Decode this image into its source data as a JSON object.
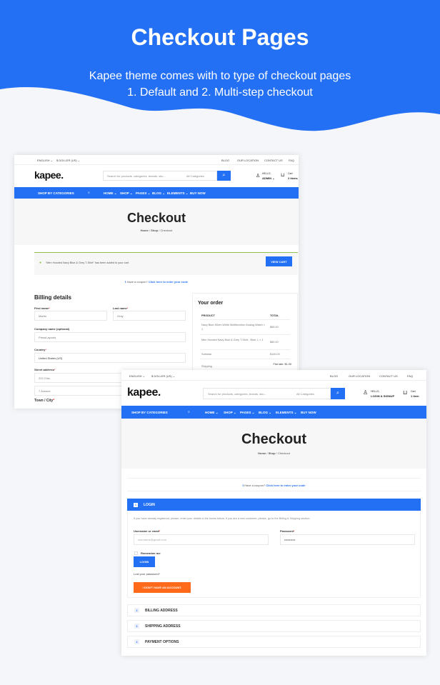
{
  "banner": {
    "title": "Checkout Pages",
    "line1": "Kapee theme comes with to type of  checkout pages",
    "line2": "1. Default and 2. Multi-step checkout",
    "color": "#2370f4"
  },
  "shot1": {
    "topbar": {
      "language": "ENGLISH ⌄",
      "currency": "$ DOLLER (US) ⌄",
      "blog": "BLOG",
      "location": "OUR LOCATION",
      "contact": "CONTACT US",
      "faq": "FAQ"
    },
    "header": {
      "logo": "kapee.",
      "search_placeholder": "Search for products, categories, brands, sku...",
      "category": "All Categories",
      "account_hello": "HELLO,",
      "account_name": "ADMIN ⌄",
      "cart_label": "Cart",
      "cart_count": "2 items"
    },
    "nav": {
      "categories": "SHOP BY CATEGORIES",
      "items": [
        "HOME ⌄",
        "SHOP ⌄",
        "PAGES ⌄",
        "BLOG ⌄",
        "ELEMENTS ⌄",
        "BUY NOW"
      ]
    },
    "hero": {
      "title": "Checkout",
      "bc_home": "Home",
      "bc_shop": "Shop",
      "bc_current": "Checkout",
      "sep": "/"
    },
    "notice": {
      "text": "“Men Hooded Navy Blue & Grey T-Shirt” has been added to your cart.",
      "button": "VIEW CART"
    },
    "coupon": {
      "text": "Have a coupon?",
      "link": "Click here to enter your code"
    },
    "billing": {
      "title": "Billing details",
      "first_name_label": "First name",
      "first_name": "Martin",
      "last_name_label": "Last name",
      "last_name": "Gray",
      "company_label": "Company name (optional)",
      "company": "PressLayouts",
      "country_label": "Country",
      "country": "United States (US)",
      "street_label": "Street address",
      "street1": "222 Chic,",
      "street2": "7 Avenue",
      "town_label": "Town / City"
    },
    "order": {
      "title": "Your order",
      "col_product": "PRODUCT",
      "col_total": "TOTAL",
      "rows": [
        {
          "product": "Navy Blue-Silver-White Multifunction Analog Watch  × 1",
          "total": "$65.00"
        },
        {
          "product": "Men Hooded Navy Blue & Grey T-Shirt - Blue, L  × 1",
          "total": "$80.00"
        },
        {
          "product": "Subtotal",
          "total": "$145.00"
        },
        {
          "product": "Shipping",
          "total": "Flat rate: $1.00"
        }
      ]
    }
  },
  "shot2": {
    "topbar": {
      "language": "ENGLISH ⌄",
      "currency": "$ DOLLER (US) ⌄",
      "blog": "BLOG",
      "location": "OUR LOCATION",
      "contact": "CONTACT US",
      "faq": "FAQ"
    },
    "header": {
      "logo": "kapee.",
      "search_placeholder": "Search for products, categories, brands, sku...",
      "category": "All Categories",
      "account_hello": "HELLO,",
      "account_name": "LOGIN & SIGNUP",
      "cart_label": "Cart",
      "cart_count": "1 item"
    },
    "nav": {
      "categories": "SHOP BY CATEGORIES",
      "items": [
        "HOME ⌄",
        "SHOP ⌄",
        "PAGES ⌄",
        "BLOG ⌄",
        "ELEMENTS ⌄",
        "BUY NOW"
      ]
    },
    "hero": {
      "title": "Checkout",
      "bc_home": "Home",
      "bc_shop": "Shop",
      "bc_current": "Checkout",
      "sep": "/"
    },
    "coupon": {
      "text": "Have a coupon?",
      "link": "Click here to enter your code"
    },
    "login": {
      "step": "1",
      "title": "LOGIN",
      "description": "If you have already registered, please, enter your details in the boxes below. If you are a new customer, please, go to the Billing & Shipping section.",
      "username_label": "Username or email",
      "username_placeholder": "username@gmail.com",
      "password_label": "Password",
      "password_value": "•••••••••••",
      "remember": "Remember me",
      "login_button": "LOGIN",
      "lost_password": "Lost your password?",
      "no_account_button": "I DON'T HAVE AN ACCOUNT."
    },
    "steps": [
      {
        "num": "2",
        "label": "BILLING ADDRESS"
      },
      {
        "num": "3",
        "label": "SHIPPING ADDRESS"
      },
      {
        "num": "4",
        "label": "PAYMENT OPTIONS"
      }
    ]
  }
}
